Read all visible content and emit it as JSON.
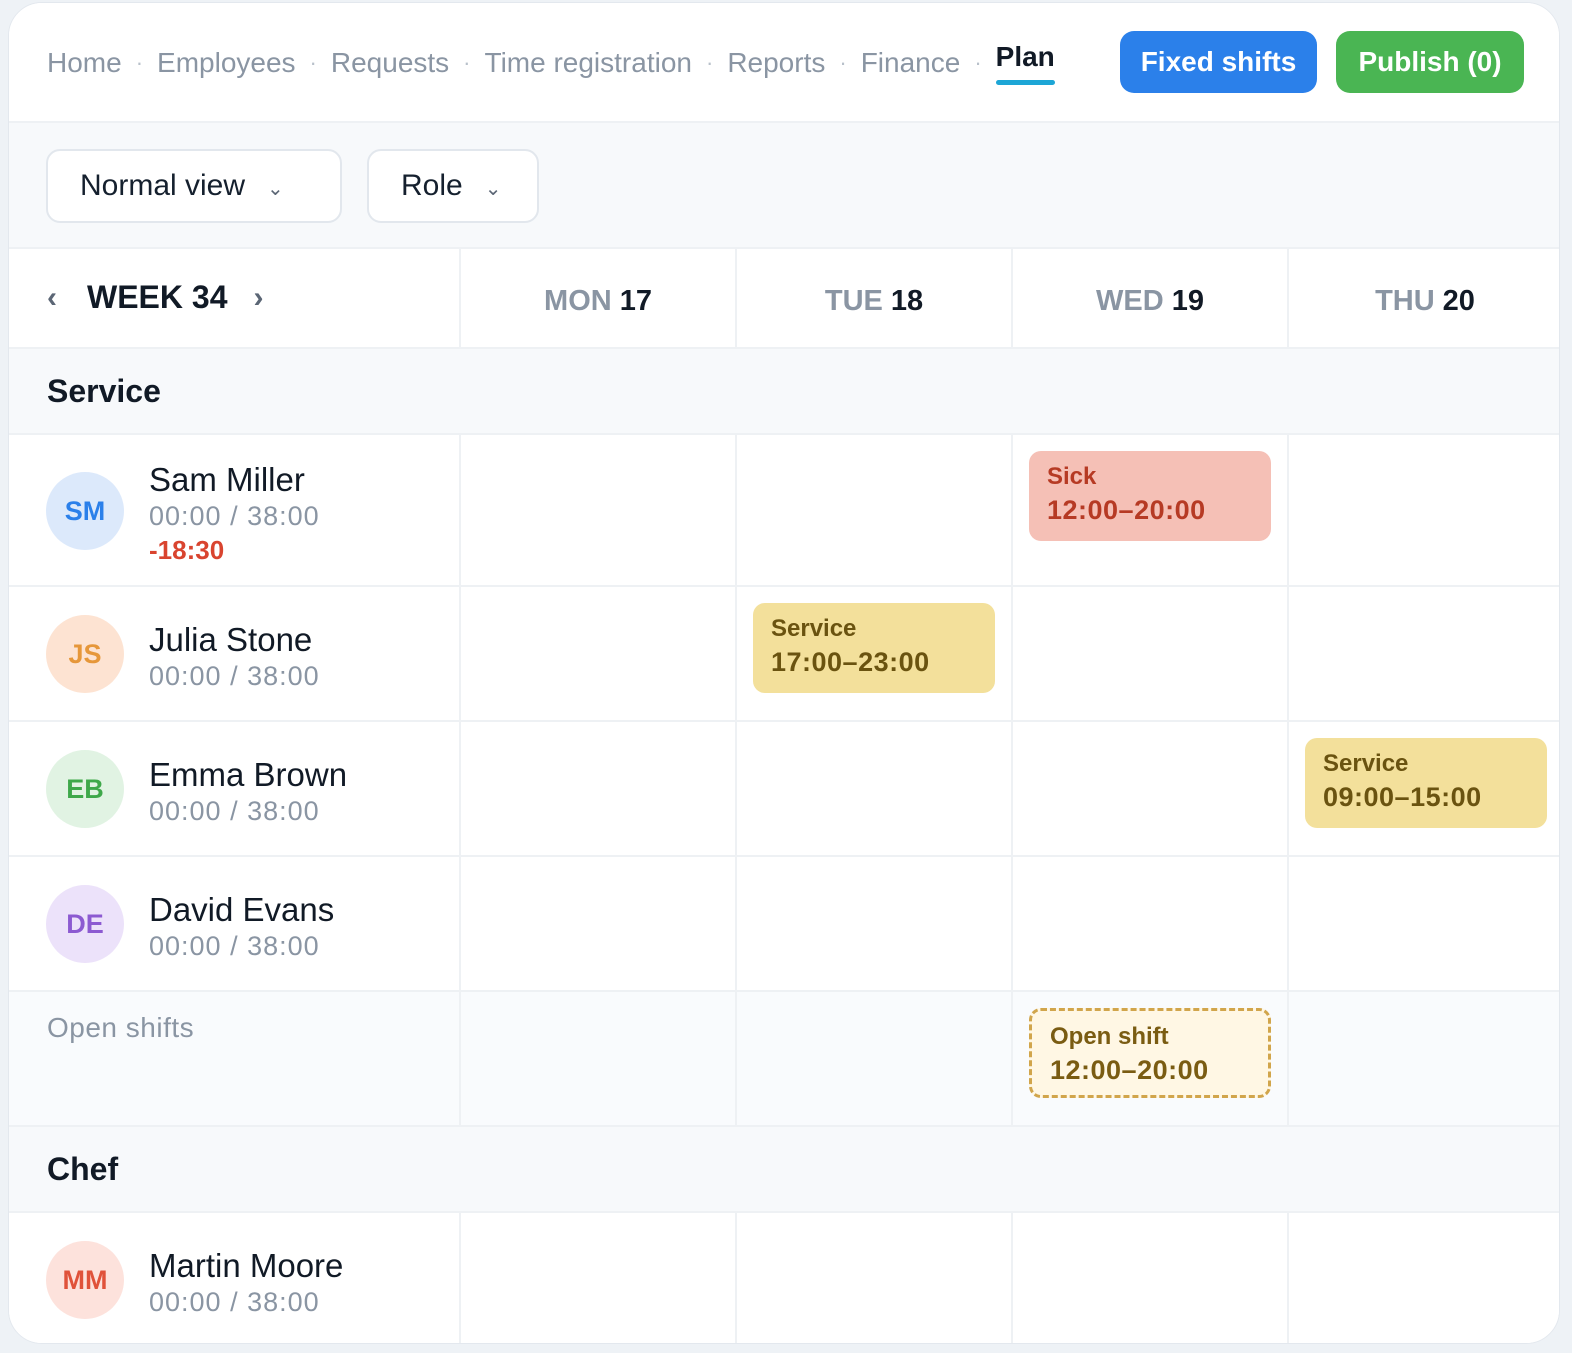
{
  "nav": {
    "links": [
      "Home",
      "Employees",
      "Requests",
      "Time registration",
      "Reports",
      "Finance"
    ],
    "active": "Plan",
    "separator": "·",
    "fixed_shifts": "Fixed shifts",
    "publish": "Publish (0)"
  },
  "toolbar": {
    "view": "Normal view",
    "role": "Role",
    "chevron": "⌄"
  },
  "week": {
    "prev": "‹",
    "label": "WEEK 34",
    "next": "›",
    "days": [
      {
        "name": "MON",
        "num": "17"
      },
      {
        "name": "TUE",
        "num": "18"
      },
      {
        "name": "WED",
        "num": "19"
      },
      {
        "name": "THU",
        "num": "20"
      }
    ]
  },
  "groups": {
    "service": "Service",
    "chef": "Chef"
  },
  "employees": [
    {
      "initials": "SM",
      "name": "Sam Miller",
      "hours": "00:00 / 38:00",
      "balance": "-18:30",
      "avatar_bg": "#dce9fb",
      "avatar_fg": "#2b80ea"
    },
    {
      "initials": "JS",
      "name": "Julia Stone",
      "hours": "00:00 / 38:00",
      "avatar_bg": "#fde3d2",
      "avatar_fg": "#e6973a"
    },
    {
      "initials": "EB",
      "name": "Emma Brown",
      "hours": "00:00 / 38:00",
      "avatar_bg": "#e1f3e3",
      "avatar_fg": "#3ea84a"
    },
    {
      "initials": "DE",
      "name": "David Evans",
      "hours": "00:00 / 38:00",
      "avatar_bg": "#ece2fa",
      "avatar_fg": "#8c5ad1"
    },
    {
      "initials": "MM",
      "name": "Martin Moore",
      "hours": "00:00 / 38:00",
      "avatar_bg": "#fde2dc",
      "avatar_fg": "#e0523a"
    }
  ],
  "shifts": {
    "sick": {
      "type": "Sick",
      "time": "12:00–20:00"
    },
    "julia": {
      "type": "Service",
      "time": "17:00–23:00"
    },
    "emma": {
      "type": "Service",
      "time": "09:00–15:00"
    },
    "open": {
      "type": "Open shift",
      "time": "12:00–20:00"
    }
  },
  "open_shifts_label": "Open shifts",
  "colors": {
    "accent": "#1da6d6",
    "fixed_button": "#2b80ea",
    "publish_button": "#4ab553",
    "negative": "#d9442f"
  }
}
